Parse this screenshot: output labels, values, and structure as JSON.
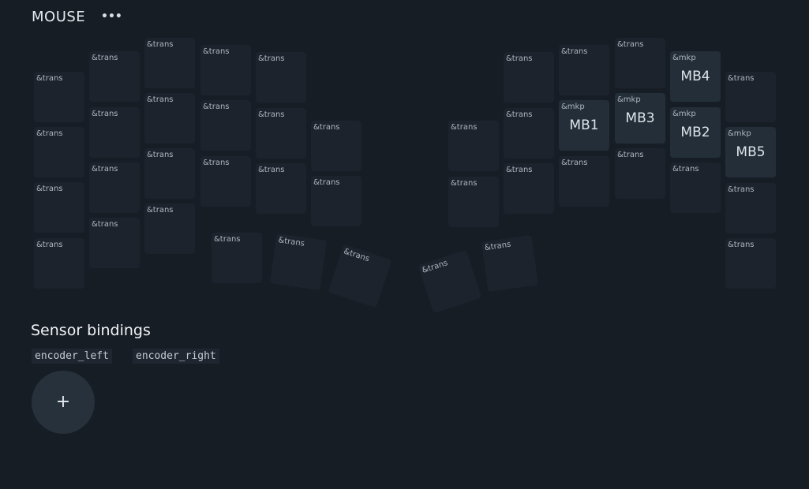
{
  "layer": {
    "name": "MOUSE",
    "menu_glyph": "•••"
  },
  "keys": [
    {
      "behavior": "&trans",
      "param": ""
    },
    {
      "behavior": "&trans",
      "param": ""
    },
    {
      "behavior": "&trans",
      "param": ""
    },
    {
      "behavior": "&trans",
      "param": ""
    },
    {
      "behavior": "&trans",
      "param": ""
    },
    {
      "behavior": "&trans",
      "param": ""
    },
    {
      "behavior": "&trans",
      "param": ""
    },
    {
      "behavior": "&trans",
      "param": ""
    },
    {
      "behavior": "&trans",
      "param": ""
    },
    {
      "behavior": "&trans",
      "param": ""
    },
    {
      "behavior": "&trans",
      "param": ""
    },
    {
      "behavior": "&trans",
      "param": ""
    },
    {
      "behavior": "&trans",
      "param": ""
    },
    {
      "behavior": "&trans",
      "param": ""
    },
    {
      "behavior": "&trans",
      "param": ""
    },
    {
      "behavior": "&trans",
      "param": ""
    },
    {
      "behavior": "&trans",
      "param": ""
    },
    {
      "behavior": "&trans",
      "param": ""
    },
    {
      "behavior": "&trans",
      "param": ""
    },
    {
      "behavior": "&trans",
      "param": ""
    },
    {
      "behavior": "&trans",
      "param": ""
    },
    {
      "behavior": "&trans",
      "param": ""
    },
    {
      "behavior": "&trans",
      "param": ""
    },
    {
      "behavior": "&trans",
      "param": ""
    },
    {
      "behavior": "&trans",
      "param": ""
    },
    {
      "behavior": "&trans",
      "param": ""
    },
    {
      "behavior": "&trans",
      "param": ""
    },
    {
      "behavior": "&trans",
      "param": ""
    },
    {
      "behavior": "&trans",
      "param": ""
    },
    {
      "behavior": "&trans",
      "param": ""
    },
    {
      "behavior": "&trans",
      "param": ""
    },
    {
      "behavior": "&trans",
      "param": ""
    },
    {
      "behavior": "&trans",
      "param": ""
    },
    {
      "behavior": "&trans",
      "param": ""
    },
    {
      "behavior": "&trans",
      "param": ""
    },
    {
      "behavior": "&trans",
      "param": ""
    },
    {
      "behavior": "&trans",
      "param": ""
    },
    {
      "behavior": "&mkp",
      "param": "MB1"
    },
    {
      "behavior": "&trans",
      "param": ""
    },
    {
      "behavior": "&trans",
      "param": ""
    },
    {
      "behavior": "&mkp",
      "param": "MB3"
    },
    {
      "behavior": "&trans",
      "param": ""
    },
    {
      "behavior": "&mkp",
      "param": "MB4"
    },
    {
      "behavior": "&mkp",
      "param": "MB2"
    },
    {
      "behavior": "&trans",
      "param": ""
    },
    {
      "behavior": "&trans",
      "param": ""
    },
    {
      "behavior": "&mkp",
      "param": "MB5"
    },
    {
      "behavior": "&trans",
      "param": ""
    },
    {
      "behavior": "&trans",
      "param": ""
    },
    {
      "behavior": "&trans",
      "param": ""
    },
    {
      "behavior": "&trans",
      "param": ""
    },
    {
      "behavior": "&trans",
      "param": ""
    },
    {
      "behavior": "&trans",
      "param": ""
    },
    {
      "behavior": "&trans",
      "param": ""
    },
    {
      "behavior": "&trans",
      "param": ""
    },
    {
      "behavior": "&trans",
      "param": ""
    },
    {
      "behavior": "&trans",
      "param": ""
    },
    {
      "behavior": "&trans",
      "param": ""
    },
    {
      "behavior": "&trans",
      "param": ""
    },
    {
      "behavior": "&trans",
      "param": ""
    },
    {
      "behavior": "&trans",
      "param": ""
    }
  ],
  "sensors": {
    "title": "Sensor bindings",
    "items": [
      "encoder_left",
      "encoder_right"
    ]
  },
  "add_button": {
    "label": "+"
  }
}
